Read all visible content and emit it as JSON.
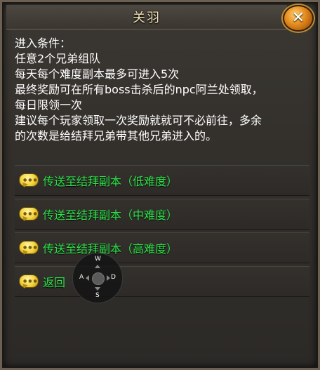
{
  "dialog": {
    "title": "关羽",
    "close_label": "✕"
  },
  "content": {
    "lines": [
      "进入条件：",
      "任意2个兄弟组队",
      "每天每个难度副本最多可进入5次",
      "最终奖励可在所有boss击杀后的npc阿兰处领取，",
      "每日限领一次",
      "建议每个玩家领取一次奖励就就可不必前往，多余",
      "的次数是给结拜兄弟带其他兄弟进入的。"
    ]
  },
  "options": [
    {
      "label": "传送至结拜副本（低难度）"
    },
    {
      "label": "传送至结拜副本（中难度）"
    },
    {
      "label": "传送至结拜副本（高难度）"
    },
    {
      "label": "返回"
    }
  ],
  "joystick": {
    "up": "W",
    "left": "A",
    "right": "D",
    "down": "S"
  },
  "colors": {
    "option_text": "#2ee24a",
    "body_text": "#ffffff",
    "title_text": "#f3e2bc"
  }
}
